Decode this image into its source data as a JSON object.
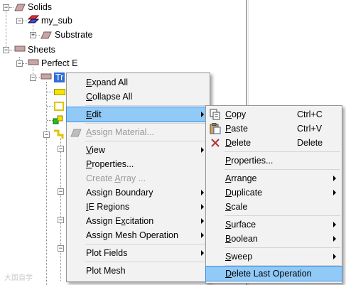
{
  "tree": {
    "nodes": {
      "solids": "Solids",
      "my_sub": "my_sub",
      "substrate": "Substrate",
      "sheets": "Sheets",
      "perfect_e": "Perfect E",
      "selected_item": "Tr"
    }
  },
  "context_menu": {
    "items": [
      {
        "label": "Expand All",
        "accel": "E"
      },
      {
        "label": "Collapse All",
        "accel": "C"
      },
      {
        "label": "Edit",
        "accel": "E"
      },
      {
        "label": "Assign Material...",
        "accel": "A"
      },
      {
        "label": "View",
        "accel": "V"
      },
      {
        "label": "Properties...",
        "accel": "P"
      },
      {
        "label": "Create Array ...",
        "accel": "A"
      },
      {
        "label": "Assign Boundary",
        "accel": ""
      },
      {
        "label": "IE Regions",
        "accel": "I"
      },
      {
        "label": "Assign Excitation",
        "accel": "x"
      },
      {
        "label": "Assign Mesh Operation",
        "accel": ""
      },
      {
        "label": "Plot Fields",
        "accel": ""
      },
      {
        "label": "Plot Mesh",
        "accel": ""
      }
    ]
  },
  "edit_submenu": {
    "items": [
      {
        "label": "Copy",
        "shortcut": "Ctrl+C",
        "icon": "copy-icon"
      },
      {
        "label": "Paste",
        "shortcut": "Ctrl+V",
        "icon": "paste-icon"
      },
      {
        "label": "Delete",
        "shortcut": "Delete",
        "icon": "delete-x-icon"
      },
      {
        "label": "Properties..."
      },
      {
        "label": "Arrange"
      },
      {
        "label": "Duplicate"
      },
      {
        "label": "Scale"
      },
      {
        "label": "Surface"
      },
      {
        "label": "Boolean"
      },
      {
        "label": "Sweep"
      },
      {
        "label": "Delete Last Operation"
      }
    ]
  },
  "watermark": "大国自学"
}
